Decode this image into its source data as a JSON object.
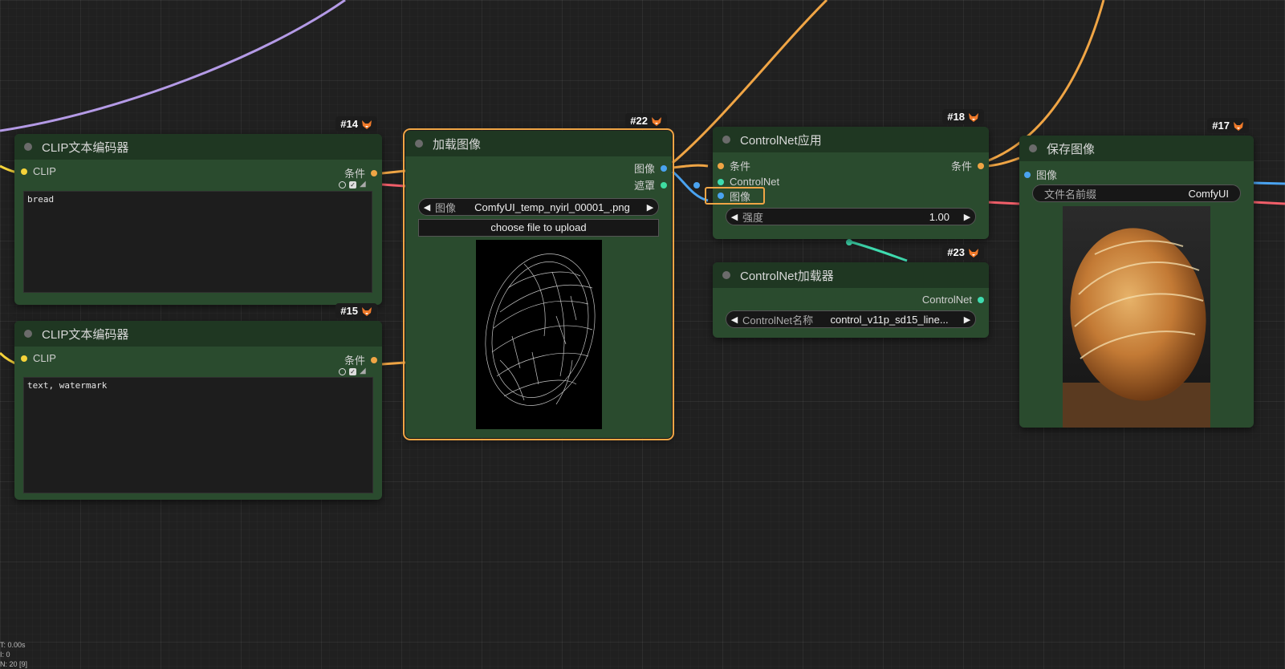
{
  "nodes": {
    "clip14": {
      "id_badge": "#14",
      "title": "CLIP文本编码器",
      "input_label": "CLIP",
      "output_label": "条件",
      "text": "bread"
    },
    "clip15": {
      "id_badge": "#15",
      "title": "CLIP文本编码器",
      "input_label": "CLIP",
      "output_label": "条件",
      "text": "text, watermark"
    },
    "load_image": {
      "id_badge": "#22",
      "title": "加载图像",
      "output_image_label": "图像",
      "output_mask_label": "遮罩",
      "image_combo_label": "图像",
      "image_combo_value": "ComfyUI_temp_nyirl_00001_.png",
      "upload_button": "choose file to upload"
    },
    "controlnet_apply": {
      "id_badge": "#18",
      "title": "ControlNet应用",
      "input_cond_label": "条件",
      "input_controlnet_label": "ControlNet",
      "input_image_label": "图像",
      "output_label": "条件",
      "strength_label": "强度",
      "strength_value": "1.00"
    },
    "controlnet_loader": {
      "id_badge": "#23",
      "title": "ControlNet加载器",
      "output_label": "ControlNet",
      "name_label": "ControlNet名称",
      "name_value": "control_v11p_sd15_line..."
    },
    "save_image": {
      "id_badge": "#17",
      "title": "保存图像",
      "input_label": "图像",
      "prefix_label": "文件名前缀",
      "prefix_value": "ComfyUI"
    }
  },
  "stats": {
    "time": "T: 0.00s",
    "line2": "I: 0",
    "line3": "N: 20 [9]"
  },
  "colors": {
    "conditioning": "#f0a545",
    "clip": "#f5d33a",
    "image": "#4aa3f0",
    "mask": "#3fdca0",
    "controlnet": "#3fdcb0",
    "latent_red": "#f25f6a",
    "vae_purple": "#b49ae6",
    "selected": "#f0a545"
  },
  "icons": {
    "badge": "fox-icon"
  }
}
